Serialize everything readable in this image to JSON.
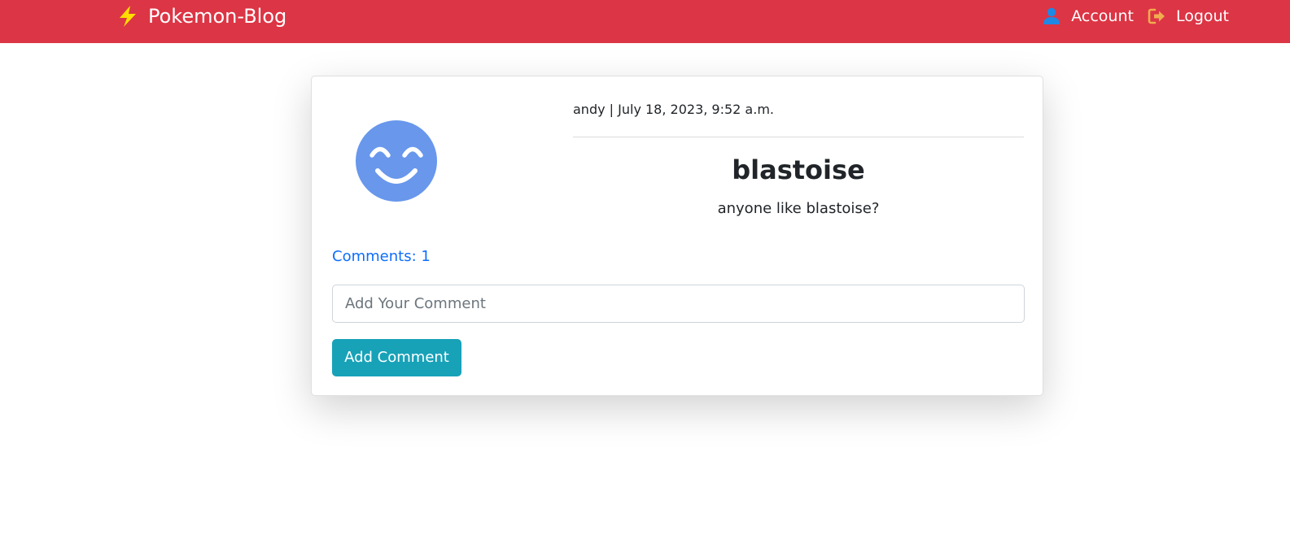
{
  "navbar": {
    "brand_label": "Pokemon-Blog",
    "brand_icon": "lightning-bolt-icon",
    "account_label": "Account",
    "account_icon": "user-icon",
    "logout_label": "Logout",
    "logout_icon": "sign-out-icon"
  },
  "post": {
    "meta": "andy | July 18, 2023, 9:52 a.m.",
    "title": "blastoise",
    "body": "anyone like blastoise?",
    "avatar_icon": "smiling-face-icon",
    "comments_label": "Comments: 1"
  },
  "comment_form": {
    "placeholder": "Add Your Comment",
    "value": "",
    "submit_label": "Add Comment"
  },
  "colors": {
    "navbar": "#dc3545",
    "bolt": "#ffdd00",
    "account_icon": "#1e88e5",
    "logout_icon": "#f0ad4e",
    "avatar": "#6897ec",
    "link": "#0d6efd",
    "button": "#17a2b8"
  }
}
